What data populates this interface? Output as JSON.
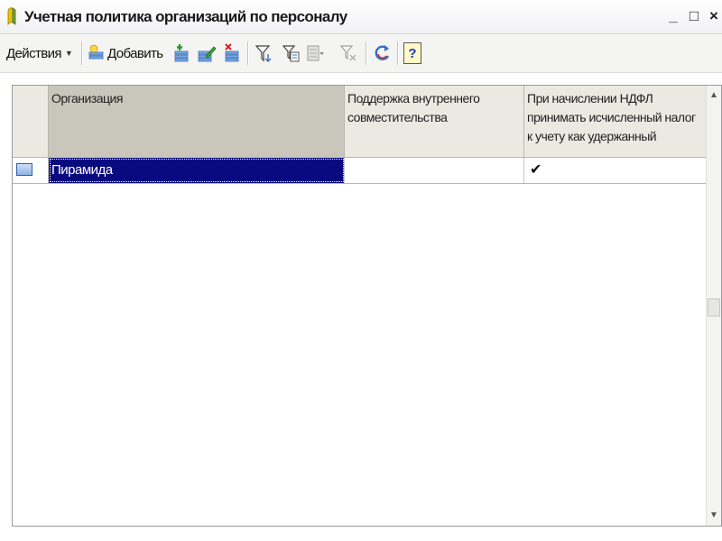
{
  "window": {
    "title": "Учетная политика организаций по персоналу",
    "minimize_glyph": "_",
    "maximize_glyph": "□",
    "close_glyph": "×"
  },
  "toolbar": {
    "actions_label": "Действия",
    "add_label": "Добавить",
    "help_glyph": "?",
    "icons": [
      "add-icon",
      "add-copy-icon",
      "edit-icon",
      "delete-icon",
      "filter-icon",
      "filter-list-icon",
      "filter-dropdown-icon",
      "clear-filter-icon",
      "refresh-icon",
      "help-icon"
    ]
  },
  "table": {
    "columns": [
      "",
      "Организация",
      "Поддержка внутреннего совместительства",
      "При начислении НДФЛ принимать исчисленный налог к учету как удержанный"
    ],
    "rows": [
      {
        "icon": "record-icon",
        "organization": "Пирамида",
        "internal_part_time": "",
        "ndfl_as_withheld": "✔"
      }
    ]
  },
  "colors": {
    "selection": "#0a0a80",
    "header_bg": "#ebe9e1",
    "sorted_column_bg": "#c9c6bc"
  }
}
